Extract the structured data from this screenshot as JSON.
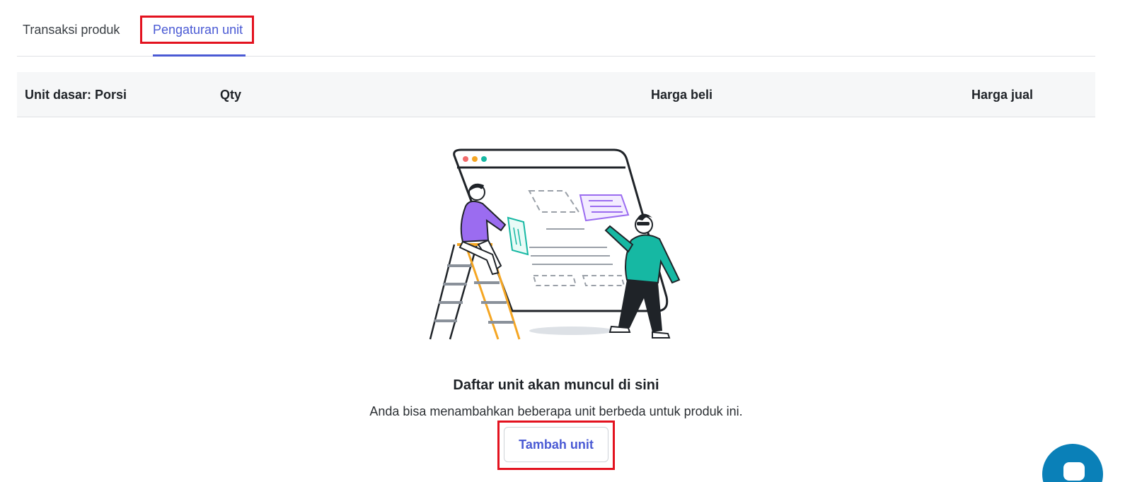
{
  "tabs": [
    {
      "label": "Transaksi produk",
      "active": false
    },
    {
      "label": "Pengaturan unit",
      "active": true
    }
  ],
  "table": {
    "headers": [
      "Unit dasar: Porsi",
      "Qty",
      "Harga beli",
      "Harga jual"
    ]
  },
  "empty_state": {
    "title": "Daftar unit akan muncul di sini",
    "description": "Anda bisa menambahkan beberapa unit berbeda untuk produk ini.",
    "button_label": "Tambah unit"
  },
  "icons": {
    "illustration": "empty-state-illustration",
    "chat": "chat-icon"
  },
  "colors": {
    "accent": "#4a5ad4",
    "highlight": "#e3121f",
    "chat": "#0a80b8"
  }
}
